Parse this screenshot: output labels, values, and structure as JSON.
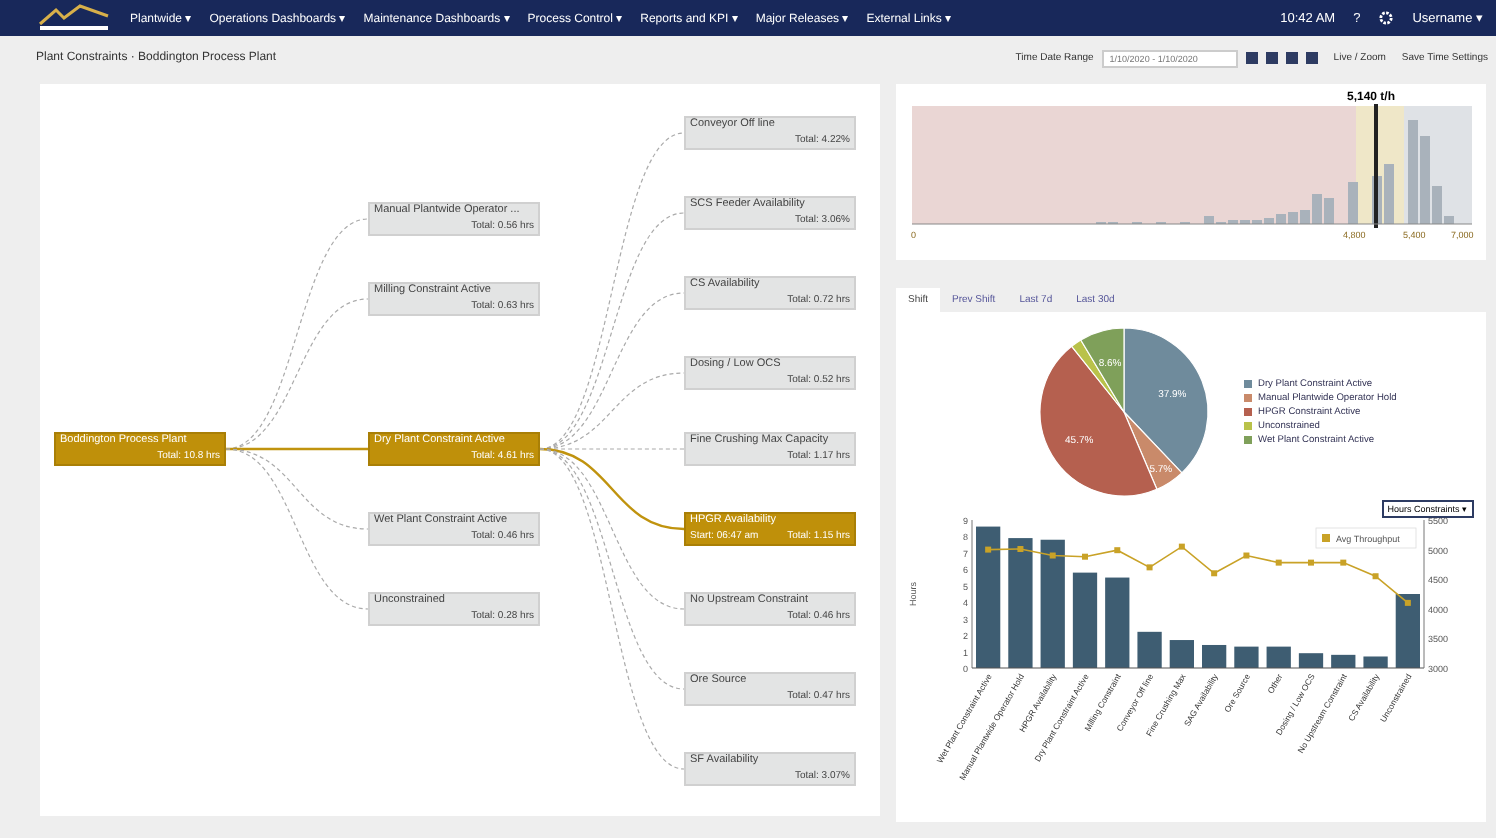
{
  "nav": {
    "menus": [
      "Plantwide ▾",
      "Operations Dashboards ▾",
      "Maintenance Dashboards ▾",
      "Process Control ▾",
      "Reports and KPI ▾",
      "Major Releases ▾",
      "External Links ▾"
    ],
    "time": "10:42 AM",
    "help": "?",
    "user": "Username ▾"
  },
  "breadcrumb": "Plant Constraints · Boddington Process Plant",
  "toolbar": {
    "range_label": "Time Date Range",
    "range_value": "1/10/2020 - 1/10/2020",
    "live": "Live / Zoom",
    "save": "Save Time Settings"
  },
  "tree": {
    "title": "Boddington Process Plant",
    "value": "Total: 10.8 hrs",
    "highlighted": true,
    "children": [
      {
        "title": "Manual Plantwide Operator ...",
        "value": "Total: 0.56 hrs",
        "highlighted": false
      },
      {
        "title": "Milling Constraint Active",
        "value": "Total: 0.63 hrs",
        "highlighted": false
      },
      {
        "title": "Dry Plant Constraint Active",
        "value": "Total: 4.61 hrs",
        "highlighted": true,
        "children": [
          {
            "title": "Conveyor Off line",
            "value": "Total: 4.22%",
            "highlighted": false
          },
          {
            "title": "SCS Feeder Availability",
            "value": "Total: 3.06%",
            "highlighted": false
          },
          {
            "title": "CS Availability",
            "value": "Total: 0.72 hrs",
            "highlighted": false
          },
          {
            "title": "Dosing / Low OCS",
            "value": "Total: 0.52 hrs",
            "highlighted": false
          },
          {
            "title": "Fine Crushing Max Capacity",
            "value": "Total: 1.17 hrs",
            "highlighted": false
          },
          {
            "title": "HPGR Availability",
            "value": "Total: 1.15 hrs",
            "note": "Start: 06:47 am",
            "highlighted": true
          },
          {
            "title": "No Upstream Constraint",
            "value": "Total: 0.46 hrs",
            "highlighted": false
          },
          {
            "title": "Ore Source",
            "value": "Total: 0.47 hrs",
            "highlighted": false
          },
          {
            "title": "SF Availability",
            "value": "Total: 3.07%",
            "highlighted": false
          }
        ]
      },
      {
        "title": "Wet Plant Constraint Active",
        "value": "Total: 0.46 hrs",
        "highlighted": false
      },
      {
        "title": "Unconstrained",
        "value": "Total: 0.28 hrs",
        "highlighted": false
      }
    ]
  },
  "histogram": {
    "marker_label": "5,140 t/h",
    "axis_labels": [
      "0",
      "4,800",
      "5,400",
      "7,000"
    ]
  },
  "tabs": [
    {
      "label": "Shift",
      "selected": true
    },
    {
      "label": "Prev Shift",
      "selected": false
    },
    {
      "label": "Last 7d",
      "selected": false
    },
    {
      "label": "Last 30d",
      "selected": false
    }
  ],
  "pie": {
    "chart_data": {
      "type": "pie",
      "categories": [
        "Dry Plant Constraint Active",
        "Manual Plantwide Operator Hold",
        "HPGR Constraint Active",
        "Unconstrained",
        "Wet Plant Constraint Active"
      ],
      "values": [
        37.9,
        5.7,
        45.7,
        2.1,
        8.6
      ],
      "colors": [
        "#6f8b9c",
        "#c98a6a",
        "#b5604f",
        "#b9c24a",
        "#7fa05a"
      ],
      "data_labels": true,
      "value_labels": [
        "37.9%",
        "5.7%",
        "45.7%",
        null,
        "8.6%"
      ]
    }
  },
  "bar_chart": {
    "dropdown": "Hours Constraints ▾",
    "chart_data": {
      "type": "bar",
      "ylabel": "Hours",
      "categories": [
        "Wet Plant Constraint Active",
        "Manual Plantwide Operator Hold",
        "HPGR Availability",
        "Dry Plant Constraint Active",
        "Milling Constraint",
        "Conveyor Off line",
        "Fine Crushing Max",
        "SAG Availability",
        "Ore Source",
        "Other",
        "Dosing / Low OCS",
        "No Upstream Constraint",
        "CS Availability",
        "Unconstrained"
      ],
      "values": [
        8.6,
        7.9,
        7.8,
        5.8,
        5.5,
        2.2,
        1.7,
        1.4,
        1.3,
        1.3,
        0.9,
        0.8,
        0.7,
        4.5
      ],
      "ylim": [
        0,
        9
      ],
      "yticks": [
        0,
        1,
        2,
        3,
        4,
        5,
        6,
        7,
        8,
        9
      ]
    },
    "throughput": {
      "chart_data": {
        "type": "line",
        "series": [
          {
            "name": "Avg Throughput",
            "color": "#c9a227",
            "marker": true,
            "values": [
              5000,
              5010,
              4900,
              4880,
              4990,
              4700,
              5050,
              4600,
              4900,
              4780,
              4780,
              4780,
              4550,
              4100
            ]
          }
        ],
        "ylim": [
          3000,
          5500
        ],
        "yticks": [
          3000,
          3500,
          4000,
          4500,
          5000,
          5500
        ]
      }
    }
  }
}
